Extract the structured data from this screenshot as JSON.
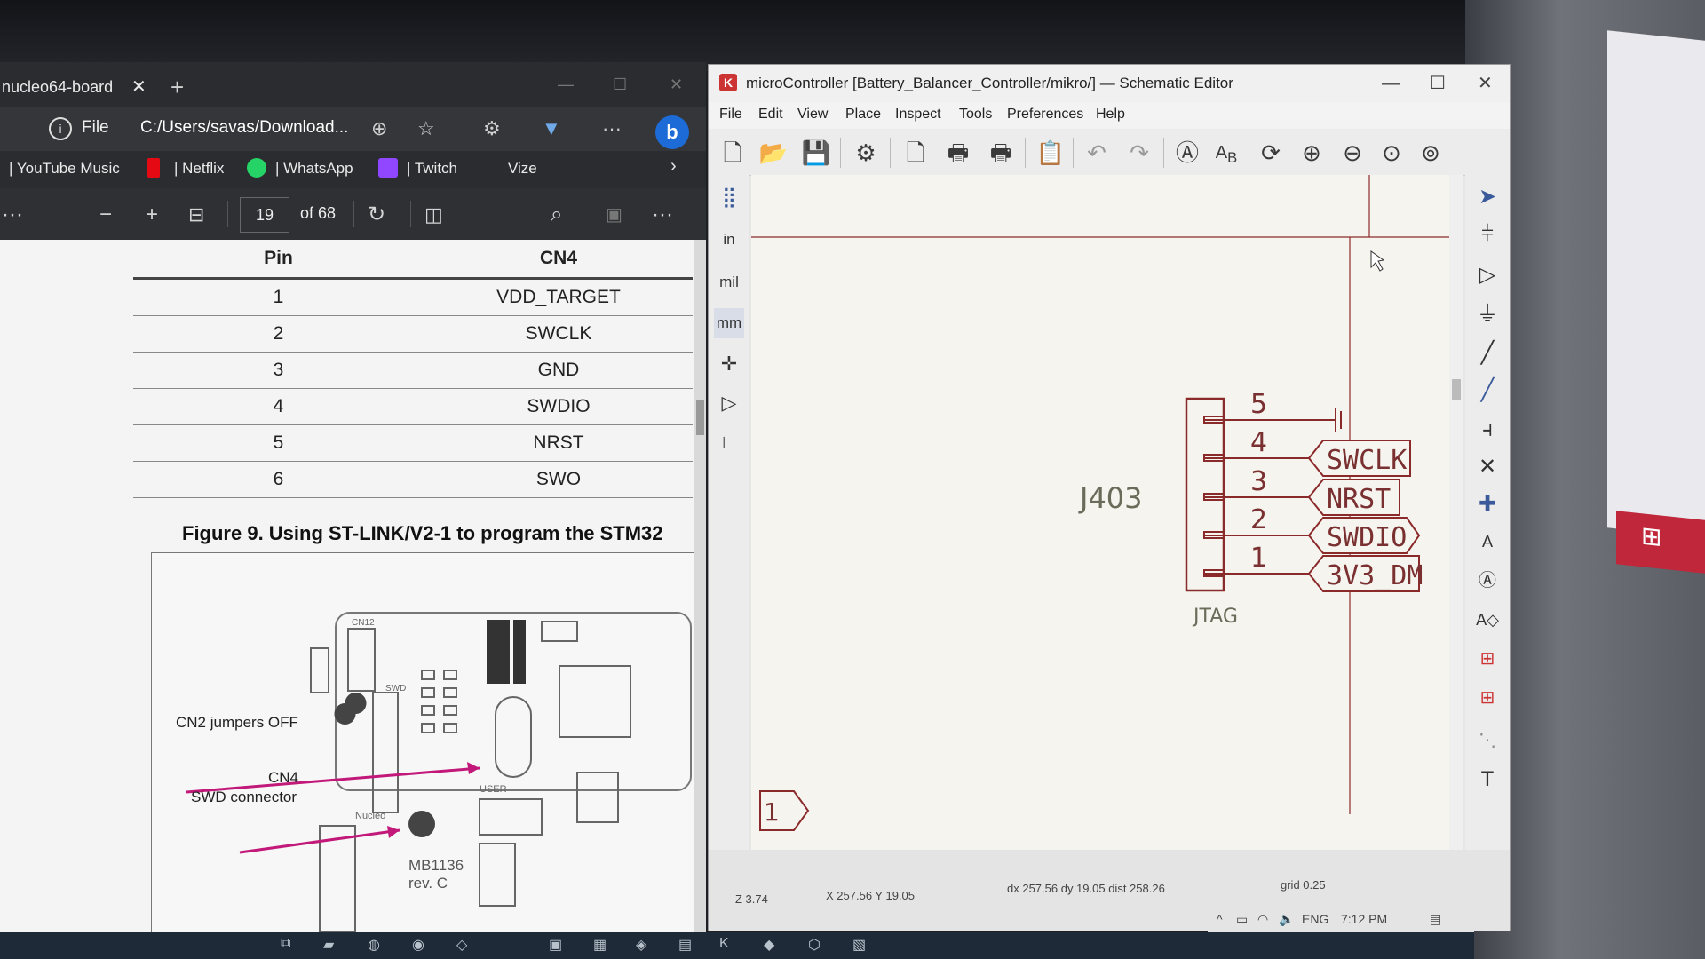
{
  "browser": {
    "tab_title": "nucleo64-board",
    "tab_close": "✕",
    "new_tab": "+",
    "address_scheme": "File",
    "address_url": "C:/Users/savas/Download...",
    "bookmarks": [
      "| YouTube Music",
      "| Netflix",
      "| WhatsApp",
      "| Twitch",
      "Vize"
    ],
    "more_label": "···",
    "pdf_toolbar": {
      "more_left": "···",
      "zoom_out": "−",
      "zoom_in": "+",
      "page_number": "19",
      "page_count": "of 68",
      "more_right": "···"
    },
    "pdf": {
      "table": {
        "headers": [
          "Pin",
          "CN4"
        ],
        "rows": [
          [
            "1",
            "VDD_TARGET"
          ],
          [
            "2",
            "SWCLK"
          ],
          [
            "3",
            "GND"
          ],
          [
            "4",
            "SWDIO"
          ],
          [
            "5",
            "NRST"
          ],
          [
            "6",
            "SWO"
          ]
        ]
      },
      "figure_caption": "Figure 9. Using ST-LINK/V2-1 to program the STM32",
      "figure_labels": {
        "cn2": "CN2 jumpers OFF",
        "cn4": "CN4",
        "swd": "SWD connector",
        "board_id": "MB1136",
        "board_rev": "rev. C",
        "silk_cn12": "CN12",
        "silk_swd": "SWD",
        "silk_nucleo": "Nucleo",
        "silk_user": "USER"
      }
    }
  },
  "kicad": {
    "title": "microController [Battery_Balancer_Controller/mikro/] — Schematic Editor",
    "menu": [
      "File",
      "Edit",
      "View",
      "Place",
      "Inspect",
      "Tools",
      "Preferences",
      "Help"
    ],
    "units": [
      "in",
      "mil",
      "mm"
    ],
    "schematic": {
      "ref": "J403",
      "value": "JTAG",
      "pins": [
        {
          "num": "5",
          "net": ""
        },
        {
          "num": "4",
          "net": "SWCLK"
        },
        {
          "num": "3",
          "net": "NRST"
        },
        {
          "num": "2",
          "net": "SWDIO"
        },
        {
          "num": "1",
          "net": "3V3_DM"
        }
      ],
      "sheet_label": "1"
    },
    "status": {
      "zoom": "Z 3.74",
      "cursor": "X 257.56  Y 19.05",
      "delta": "dx 257.56  dy 19.05  dist 258.26",
      "grid": "grid 0.25"
    }
  },
  "tray": {
    "lang": "ENG",
    "time": "7:12 PM"
  },
  "colors": {
    "schematic_line": "#8b2a2a",
    "canvas": "#f5f4ee",
    "bing": "#1c6bd7",
    "netflix": "#e50914",
    "whatsapp": "#25d366",
    "twitch": "#9146ff",
    "figure_arrow": "#c2187a"
  }
}
